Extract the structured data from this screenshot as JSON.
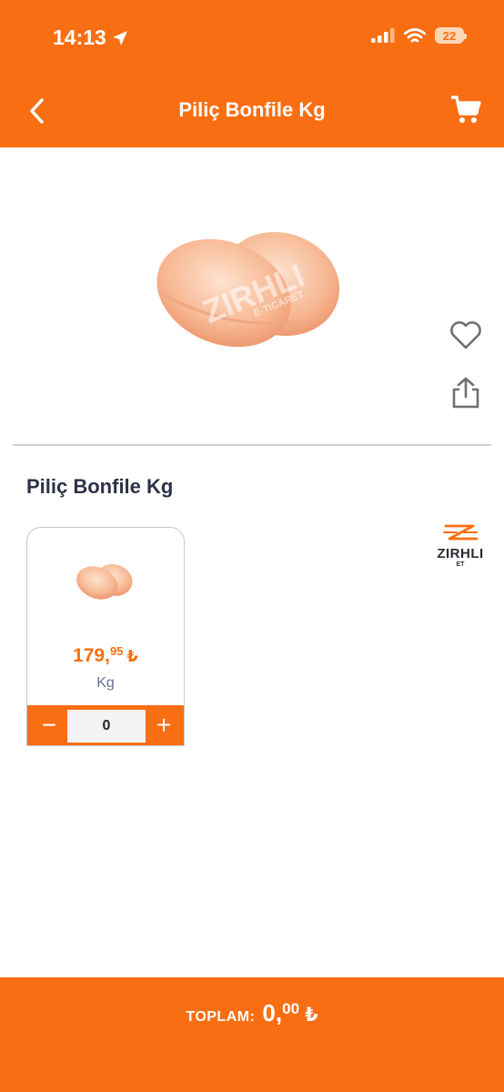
{
  "status_bar": {
    "time": "14:13",
    "battery": "22"
  },
  "nav": {
    "title": "Piliç Bonfile Kg"
  },
  "brand": {
    "name": "ZIRHLI",
    "sub": "ET"
  },
  "product": {
    "title": "Piliç Bonfile Kg",
    "price_main": "179,",
    "price_decimals": "95",
    "currency": "₺",
    "unit": "Kg",
    "quantity": "0",
    "minus_label": "−",
    "plus_label": "+"
  },
  "footer": {
    "total_label": "TOPLAM:",
    "total_main": "0,",
    "total_decimals": "00",
    "currency": "₺"
  },
  "colors": {
    "accent": "#f96e12",
    "title_text": "#2e3247",
    "unit_text": "#6a6f95"
  },
  "icons": [
    "location-arrow-icon",
    "signal-icon",
    "wifi-icon",
    "battery-icon",
    "back-chevron-icon",
    "cart-icon",
    "heart-icon",
    "share-icon"
  ]
}
